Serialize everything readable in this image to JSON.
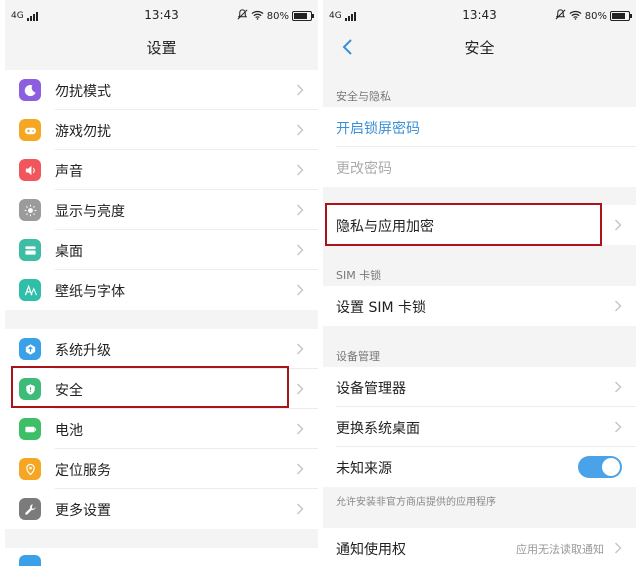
{
  "left": {
    "status": {
      "network": "4G",
      "time": "13:43",
      "battery": "80%"
    },
    "title": "设置",
    "group1": [
      {
        "label": "勿扰模式",
        "icon": "moon-icon",
        "color": "#8c5ee0"
      },
      {
        "label": "游戏勿扰",
        "icon": "gamepad-icon",
        "color": "#f5a623"
      },
      {
        "label": "声音",
        "icon": "speaker-icon",
        "color": "#f0565c"
      },
      {
        "label": "显示与亮度",
        "icon": "brightness-icon",
        "color": "#9b9b9b"
      },
      {
        "label": "桌面",
        "icon": "desktop-icon",
        "color": "#3dbda3"
      },
      {
        "label": "壁纸与字体",
        "icon": "font-icon",
        "color": "#2fbfa8"
      }
    ],
    "group2": [
      {
        "label": "系统升级",
        "icon": "upgrade-icon",
        "color": "#3aa1e8"
      },
      {
        "label": "安全",
        "icon": "shield-icon",
        "color": "#3dbb78"
      },
      {
        "label": "电池",
        "icon": "battery-icon",
        "color": "#3cbf66"
      },
      {
        "label": "定位服务",
        "icon": "location-icon",
        "color": "#f5a623"
      },
      {
        "label": "更多设置",
        "icon": "wrench-icon",
        "color": "#7b7b7b"
      }
    ]
  },
  "right": {
    "status": {
      "network": "4G",
      "time": "13:43",
      "battery": "80%"
    },
    "title": "安全",
    "sections": {
      "privacy": "安全与隐私",
      "sim": "SIM 卡锁",
      "device": "设备管理"
    },
    "items": {
      "lock_password": "开启锁屏密码",
      "change_password": "更改密码",
      "privacy_encrypt": "隐私与应用加密",
      "sim_lock": "设置 SIM 卡锁",
      "device_admin": "设备管理器",
      "change_launcher": "更换系统桌面",
      "unknown_sources": "未知来源",
      "notify_access": "通知使用权"
    },
    "unknown_sources_on": true,
    "unknown_sources_note": "允许安装非官方商店提供的应用程序",
    "notify_access_value": "应用无法读取通知"
  },
  "colors": {
    "highlight": "#a8141a",
    "accent": "#3a8fd8",
    "toggle": "#4aa3e8"
  }
}
